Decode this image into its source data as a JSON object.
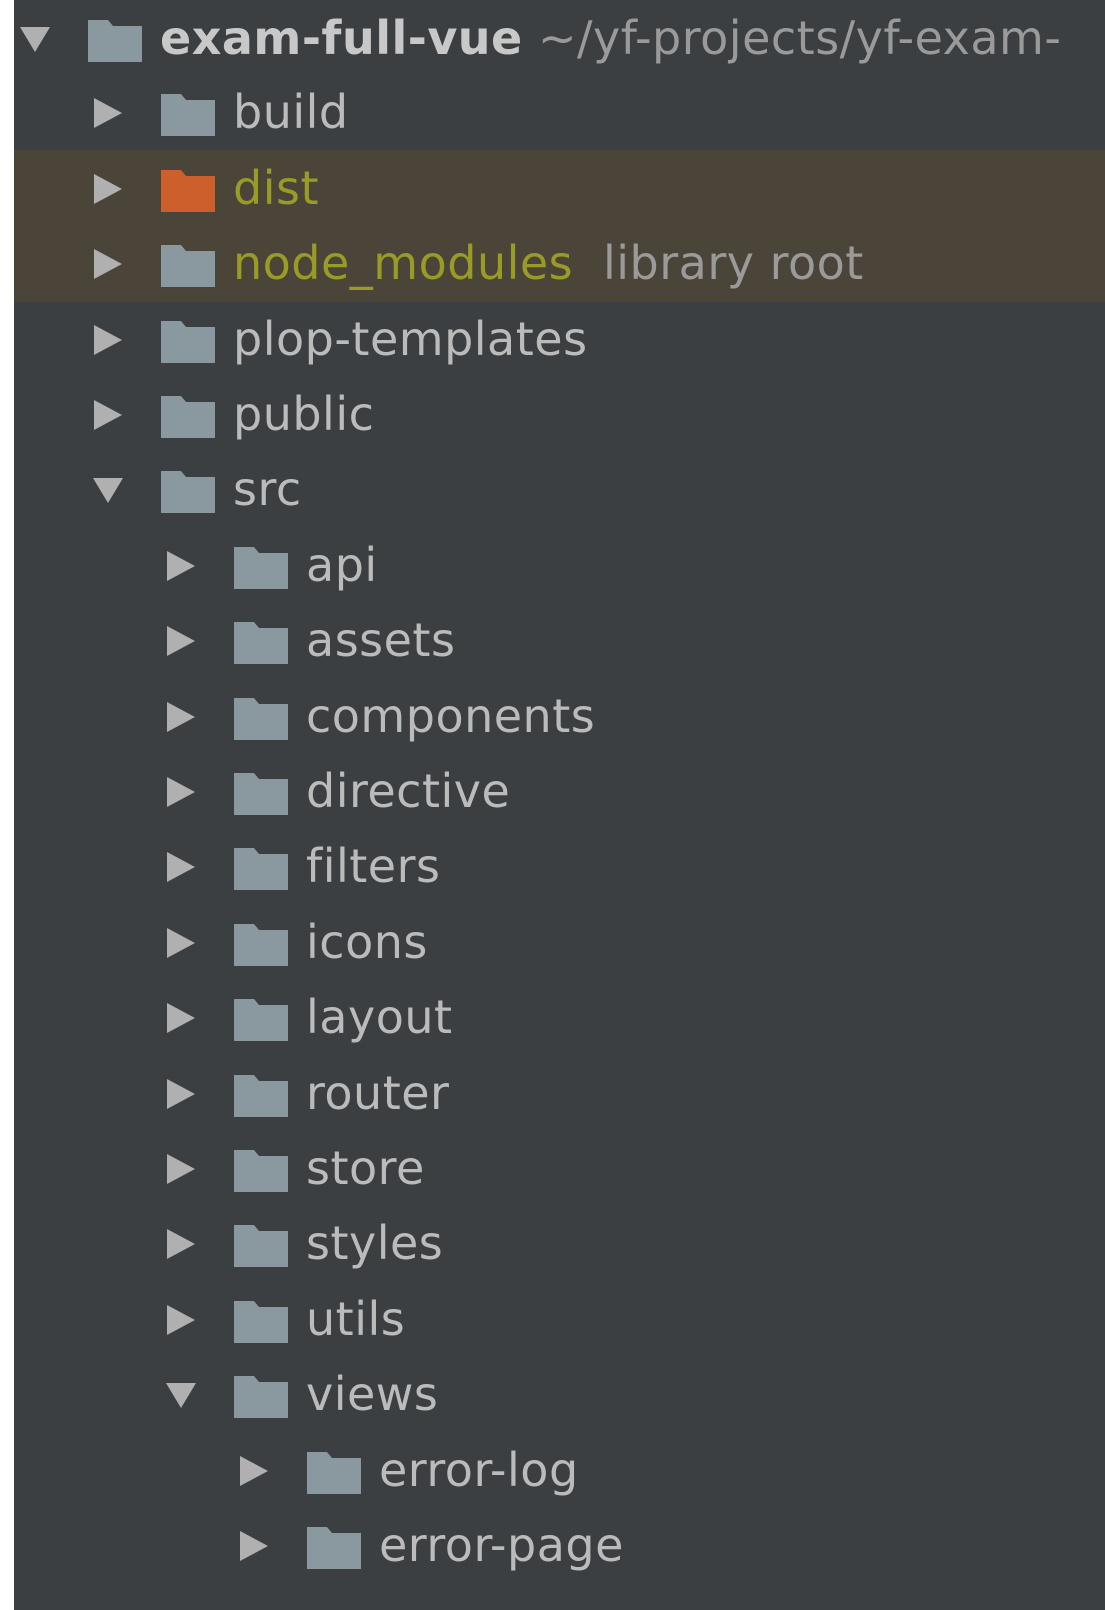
{
  "project_tree": {
    "root": {
      "name": "exam-full-vue",
      "path": "~/yf-projects/yf-exam-",
      "expanded": true
    },
    "items": [
      {
        "name": "build",
        "depth": 1,
        "expanded": false,
        "status": "normal",
        "hint": ""
      },
      {
        "name": "dist",
        "depth": 1,
        "expanded": false,
        "status": "excluded",
        "hint": ""
      },
      {
        "name": "node_modules",
        "depth": 1,
        "expanded": false,
        "status": "excluded-library",
        "hint": "library root"
      },
      {
        "name": "plop-templates",
        "depth": 1,
        "expanded": false,
        "status": "normal",
        "hint": ""
      },
      {
        "name": "public",
        "depth": 1,
        "expanded": false,
        "status": "normal",
        "hint": ""
      },
      {
        "name": "src",
        "depth": 1,
        "expanded": true,
        "status": "normal",
        "hint": ""
      },
      {
        "name": "api",
        "depth": 2,
        "expanded": false,
        "status": "normal",
        "hint": ""
      },
      {
        "name": "assets",
        "depth": 2,
        "expanded": false,
        "status": "normal",
        "hint": ""
      },
      {
        "name": "components",
        "depth": 2,
        "expanded": false,
        "status": "normal",
        "hint": ""
      },
      {
        "name": "directive",
        "depth": 2,
        "expanded": false,
        "status": "normal",
        "hint": ""
      },
      {
        "name": "filters",
        "depth": 2,
        "expanded": false,
        "status": "normal",
        "hint": ""
      },
      {
        "name": "icons",
        "depth": 2,
        "expanded": false,
        "status": "normal",
        "hint": ""
      },
      {
        "name": "layout",
        "depth": 2,
        "expanded": false,
        "status": "normal",
        "hint": ""
      },
      {
        "name": "router",
        "depth": 2,
        "expanded": false,
        "status": "normal",
        "hint": ""
      },
      {
        "name": "store",
        "depth": 2,
        "expanded": false,
        "status": "normal",
        "hint": ""
      },
      {
        "name": "styles",
        "depth": 2,
        "expanded": false,
        "status": "normal",
        "hint": ""
      },
      {
        "name": "utils",
        "depth": 2,
        "expanded": false,
        "status": "normal",
        "hint": ""
      },
      {
        "name": "views",
        "depth": 2,
        "expanded": true,
        "status": "normal",
        "hint": ""
      },
      {
        "name": "error-log",
        "depth": 3,
        "expanded": false,
        "status": "normal",
        "hint": ""
      },
      {
        "name": "error-page",
        "depth": 3,
        "expanded": false,
        "status": "normal",
        "hint": ""
      }
    ]
  },
  "icons": {
    "collapsed": "triangle-right-icon",
    "expanded": "triangle-down-icon",
    "folder": "folder-icon"
  },
  "colors": {
    "background": "#3c3f41",
    "excluded_row_background": "#4b4539",
    "text": "#bbbbbb",
    "root_text": "#c8c8c8",
    "excluded_text": "#9a9a27",
    "hint_text": "#9a9a9a",
    "folder": "#8a989f",
    "excluded_folder": "#cc5f2c",
    "arrow": "#b0b0b0"
  }
}
